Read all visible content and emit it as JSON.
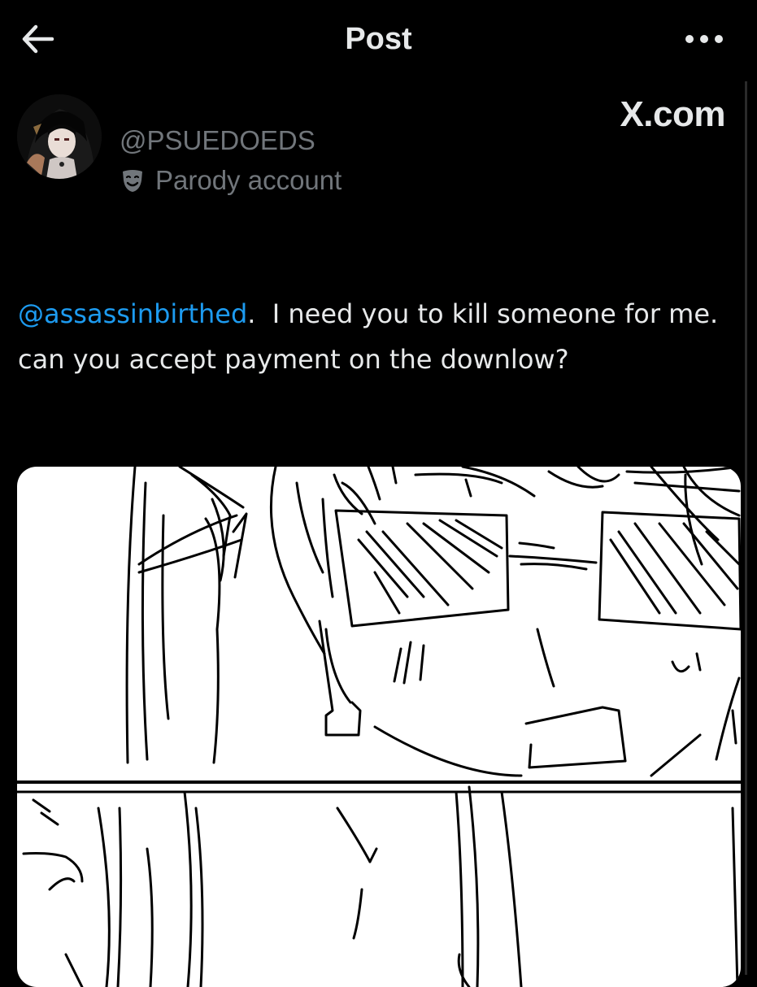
{
  "header": {
    "title": "Post",
    "back_icon": "arrow-left-icon",
    "more_icon": "ellipsis-icon"
  },
  "author": {
    "handle": "@PSUEDOEDS",
    "label": "Parody account",
    "label_icon": "parody-mask-icon"
  },
  "watermark": "X.com",
  "post": {
    "mention": "@assassinbirthed",
    "text": ".  I need you to kill someone for me.    can you accept payment on the downlow?"
  },
  "colors": {
    "background": "#000000",
    "text": "#e7e9ea",
    "secondary": "#71767b",
    "link": "#1d9bf0"
  }
}
